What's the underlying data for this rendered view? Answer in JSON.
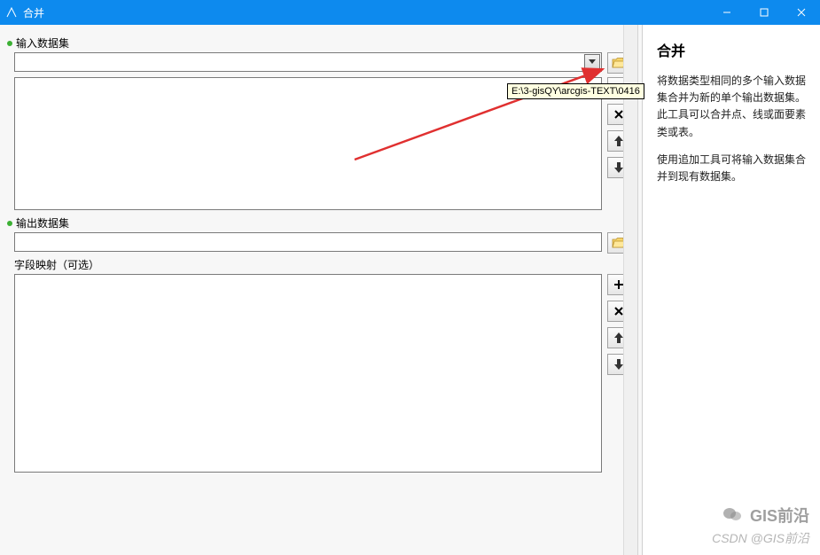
{
  "window": {
    "title": "合并",
    "minimize": "—",
    "maximize": "☐",
    "close": "✕"
  },
  "left_panel": {
    "input_datasets_label": "输入数据集",
    "output_dataset_label": "输出数据集",
    "field_mapping_label": "字段映射（可选）",
    "output_path_value": ""
  },
  "tooltip": {
    "text": "E:\\3-gisQY\\arcgis-TEXT\\0416"
  },
  "help_panel": {
    "title": "合并",
    "p1": "将数据类型相同的多个输入数据集合并为新的单个输出数据集。此工具可以合并点、线或面要素类或表。",
    "p2": "使用追加工具可将输入数据集合并到现有数据集。"
  },
  "watermark": {
    "line1": "GIS前沿",
    "line2": "CSDN @GIS前沿"
  }
}
